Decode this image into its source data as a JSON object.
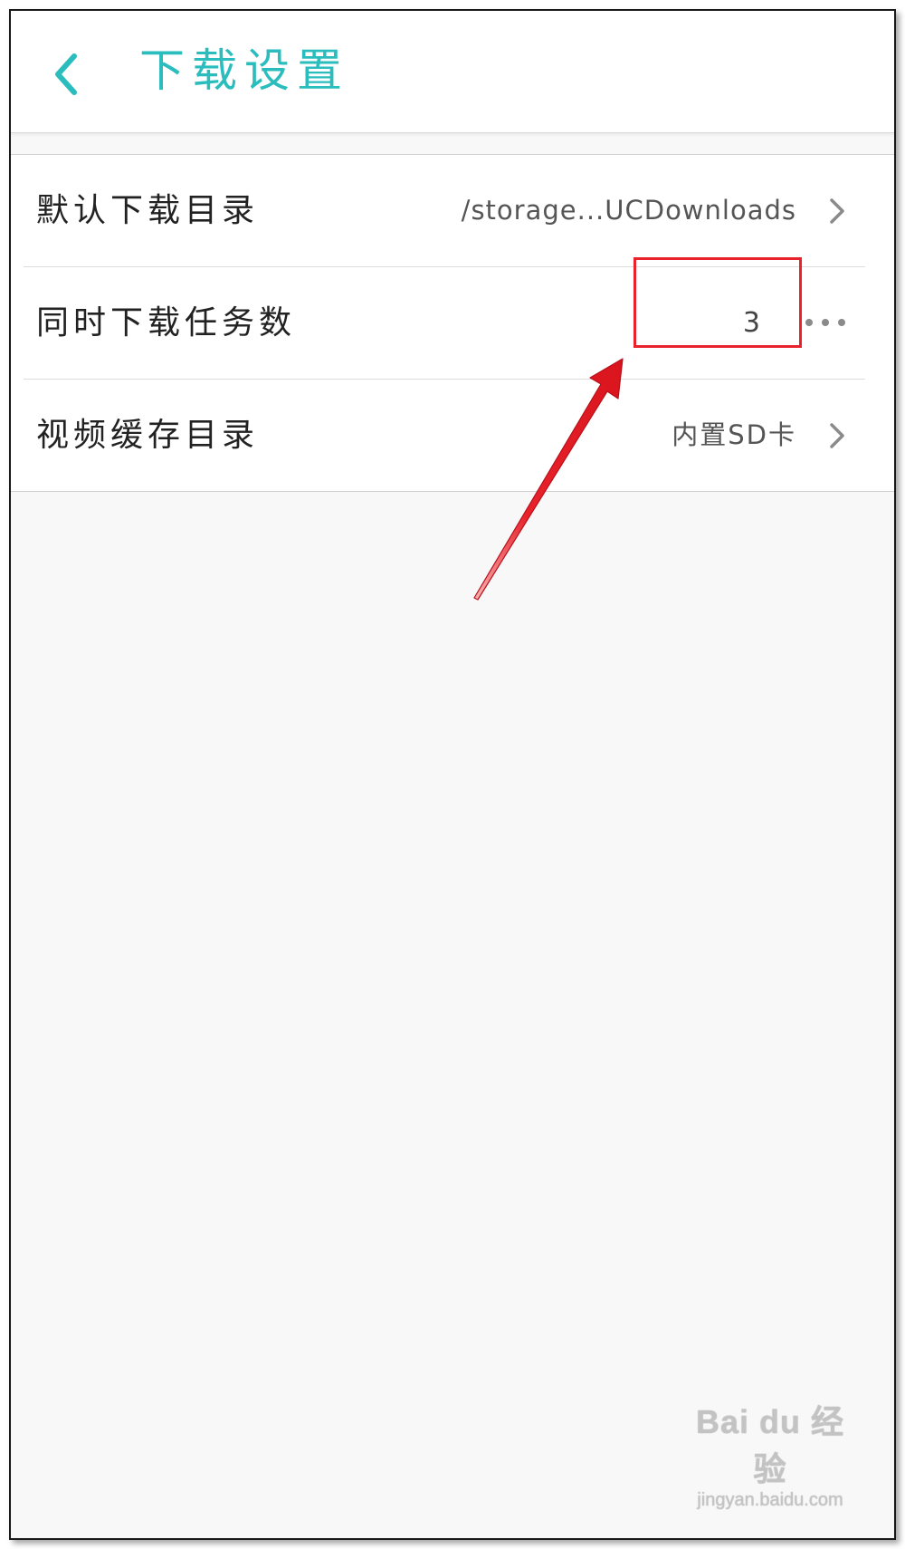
{
  "header": {
    "title": "下载设置",
    "accent_color": "#2bbdbd",
    "back_icon": "chevron-left-icon"
  },
  "settings": [
    {
      "label": "默认下载目录",
      "value": "/storage...UCDownloads",
      "trailing_icon": "chevron-right-icon"
    },
    {
      "label": "同时下载任务数",
      "value": "3",
      "trailing_icon": "more-horizontal-icon"
    },
    {
      "label": "视频缓存目录",
      "value": "内置SD卡",
      "trailing_icon": "chevron-right-icon"
    }
  ],
  "annotation": {
    "color": "#e8232b"
  },
  "watermark": {
    "logo": "Bai du 经验",
    "url": "jingyan.baidu.com"
  }
}
